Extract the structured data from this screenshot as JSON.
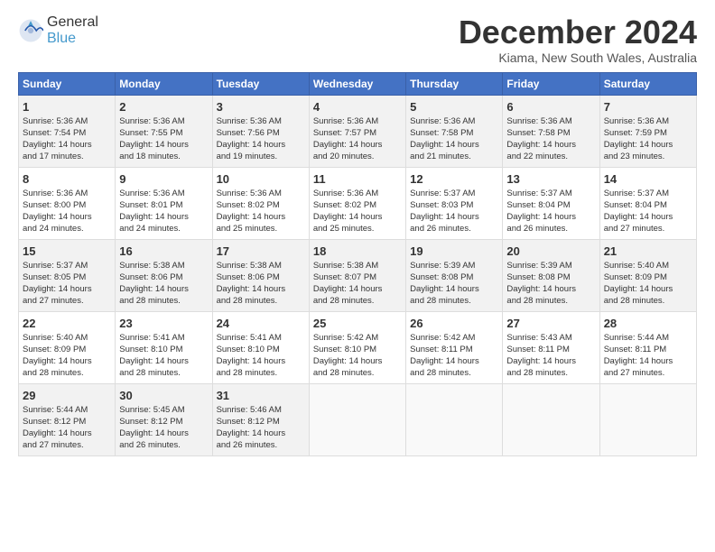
{
  "logo": {
    "line1": "General",
    "line2": "Blue"
  },
  "title": "December 2024",
  "location": "Kiama, New South Wales, Australia",
  "days_of_week": [
    "Sunday",
    "Monday",
    "Tuesday",
    "Wednesday",
    "Thursday",
    "Friday",
    "Saturday"
  ],
  "weeks": [
    [
      {
        "day": "1",
        "sunrise": "5:36 AM",
        "sunset": "7:54 PM",
        "daylight": "14 hours and 17 minutes."
      },
      {
        "day": "2",
        "sunrise": "5:36 AM",
        "sunset": "7:55 PM",
        "daylight": "14 hours and 18 minutes."
      },
      {
        "day": "3",
        "sunrise": "5:36 AM",
        "sunset": "7:56 PM",
        "daylight": "14 hours and 19 minutes."
      },
      {
        "day": "4",
        "sunrise": "5:36 AM",
        "sunset": "7:57 PM",
        "daylight": "14 hours and 20 minutes."
      },
      {
        "day": "5",
        "sunrise": "5:36 AM",
        "sunset": "7:58 PM",
        "daylight": "14 hours and 21 minutes."
      },
      {
        "day": "6",
        "sunrise": "5:36 AM",
        "sunset": "7:58 PM",
        "daylight": "14 hours and 22 minutes."
      },
      {
        "day": "7",
        "sunrise": "5:36 AM",
        "sunset": "7:59 PM",
        "daylight": "14 hours and 23 minutes."
      }
    ],
    [
      {
        "day": "8",
        "sunrise": "5:36 AM",
        "sunset": "8:00 PM",
        "daylight": "14 hours and 24 minutes."
      },
      {
        "day": "9",
        "sunrise": "5:36 AM",
        "sunset": "8:01 PM",
        "daylight": "14 hours and 24 minutes."
      },
      {
        "day": "10",
        "sunrise": "5:36 AM",
        "sunset": "8:02 PM",
        "daylight": "14 hours and 25 minutes."
      },
      {
        "day": "11",
        "sunrise": "5:36 AM",
        "sunset": "8:02 PM",
        "daylight": "14 hours and 25 minutes."
      },
      {
        "day": "12",
        "sunrise": "5:37 AM",
        "sunset": "8:03 PM",
        "daylight": "14 hours and 26 minutes."
      },
      {
        "day": "13",
        "sunrise": "5:37 AM",
        "sunset": "8:04 PM",
        "daylight": "14 hours and 26 minutes."
      },
      {
        "day": "14",
        "sunrise": "5:37 AM",
        "sunset": "8:04 PM",
        "daylight": "14 hours and 27 minutes."
      }
    ],
    [
      {
        "day": "15",
        "sunrise": "5:37 AM",
        "sunset": "8:05 PM",
        "daylight": "14 hours and 27 minutes."
      },
      {
        "day": "16",
        "sunrise": "5:38 AM",
        "sunset": "8:06 PM",
        "daylight": "14 hours and 28 minutes."
      },
      {
        "day": "17",
        "sunrise": "5:38 AM",
        "sunset": "8:06 PM",
        "daylight": "14 hours and 28 minutes."
      },
      {
        "day": "18",
        "sunrise": "5:38 AM",
        "sunset": "8:07 PM",
        "daylight": "14 hours and 28 minutes."
      },
      {
        "day": "19",
        "sunrise": "5:39 AM",
        "sunset": "8:08 PM",
        "daylight": "14 hours and 28 minutes."
      },
      {
        "day": "20",
        "sunrise": "5:39 AM",
        "sunset": "8:08 PM",
        "daylight": "14 hours and 28 minutes."
      },
      {
        "day": "21",
        "sunrise": "5:40 AM",
        "sunset": "8:09 PM",
        "daylight": "14 hours and 28 minutes."
      }
    ],
    [
      {
        "day": "22",
        "sunrise": "5:40 AM",
        "sunset": "8:09 PM",
        "daylight": "14 hours and 28 minutes."
      },
      {
        "day": "23",
        "sunrise": "5:41 AM",
        "sunset": "8:10 PM",
        "daylight": "14 hours and 28 minutes."
      },
      {
        "day": "24",
        "sunrise": "5:41 AM",
        "sunset": "8:10 PM",
        "daylight": "14 hours and 28 minutes."
      },
      {
        "day": "25",
        "sunrise": "5:42 AM",
        "sunset": "8:10 PM",
        "daylight": "14 hours and 28 minutes."
      },
      {
        "day": "26",
        "sunrise": "5:42 AM",
        "sunset": "8:11 PM",
        "daylight": "14 hours and 28 minutes."
      },
      {
        "day": "27",
        "sunrise": "5:43 AM",
        "sunset": "8:11 PM",
        "daylight": "14 hours and 28 minutes."
      },
      {
        "day": "28",
        "sunrise": "5:44 AM",
        "sunset": "8:11 PM",
        "daylight": "14 hours and 27 minutes."
      }
    ],
    [
      {
        "day": "29",
        "sunrise": "5:44 AM",
        "sunset": "8:12 PM",
        "daylight": "14 hours and 27 minutes."
      },
      {
        "day": "30",
        "sunrise": "5:45 AM",
        "sunset": "8:12 PM",
        "daylight": "14 hours and 26 minutes."
      },
      {
        "day": "31",
        "sunrise": "5:46 AM",
        "sunset": "8:12 PM",
        "daylight": "14 hours and 26 minutes."
      },
      null,
      null,
      null,
      null
    ]
  ],
  "labels": {
    "sunrise": "Sunrise:",
    "sunset": "Sunset:",
    "daylight": "Daylight:"
  }
}
